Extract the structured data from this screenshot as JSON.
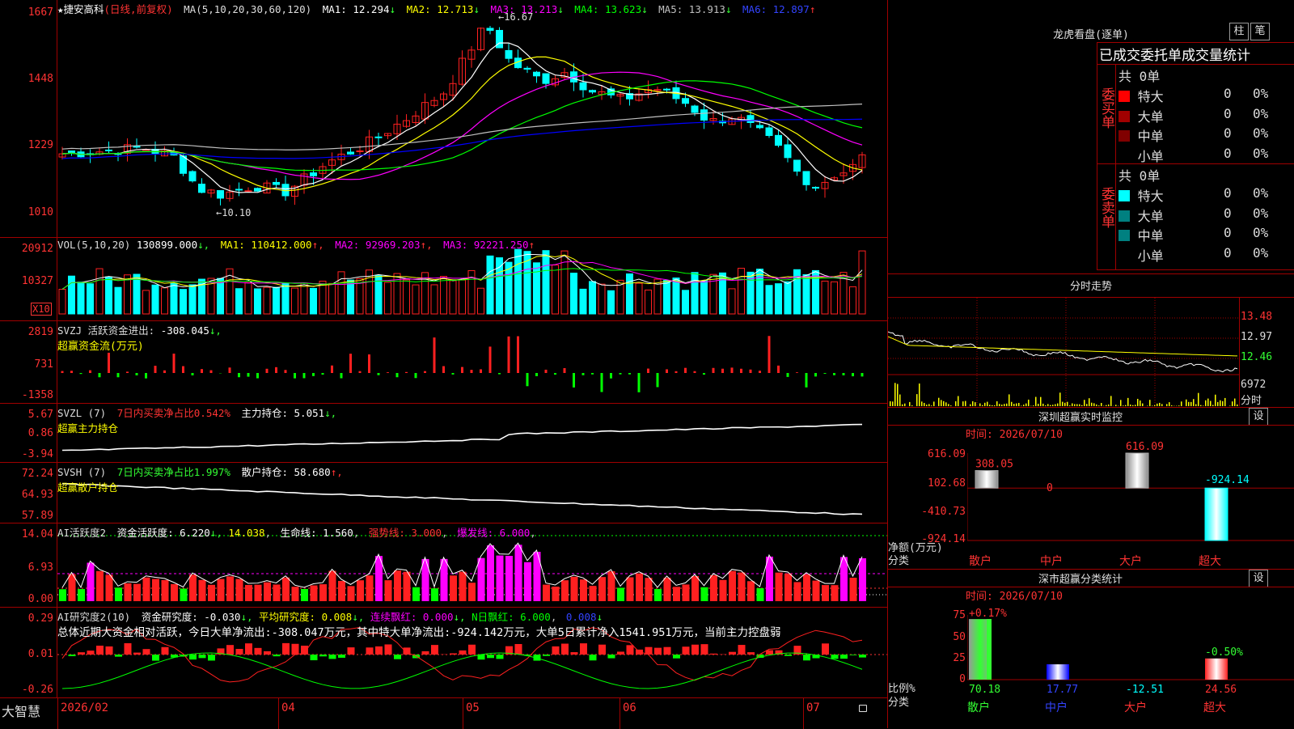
{
  "colors": {
    "up": "#ff2020",
    "down": "#00ffff",
    "ma1": "#ffffff",
    "ma2": "#ffff00",
    "ma3": "#ff00ff",
    "ma4": "#00ff00",
    "ma5": "#c0c0c0",
    "ma6": "#0000ff"
  },
  "kline": {
    "stock": "★捷安高科",
    "mode": "(日线,前复权)",
    "ma_params": "MA(5,10,20,30,60,120)",
    "ma": [
      {
        "name": "MA1:",
        "val": "12.294"
      },
      {
        "name": "MA2:",
        "val": "12.713"
      },
      {
        "name": "MA3:",
        "val": "13.213"
      },
      {
        "name": "MA4:",
        "val": "13.623"
      },
      {
        "name": "MA5:",
        "val": "13.913"
      },
      {
        "name": "MA6:",
        "val": "12.897"
      }
    ],
    "ylabels": [
      "1667",
      "1448",
      "1229",
      "1010"
    ],
    "max_label": "←16.67",
    "min_label": "←10.10"
  },
  "vol": {
    "title": "VOL(5,10,20)",
    "v": "130899.000",
    "ma1": "MA1: 110412.000",
    "ma2": "MA2: 92969.203",
    "ma3": "MA3: 92221.250",
    "ylabels": [
      "20912",
      "10327"
    ],
    "unit": "X10"
  },
  "svzj": {
    "title": "SVZJ  活跃资金进出:",
    "v": "-308.045",
    "sub": "超赢资金流(万元)",
    "ylabels": [
      "2819",
      "731",
      "-1358"
    ]
  },
  "svzl": {
    "title": "SVZL (7)",
    "pct": "7日内买卖净占比0.542%",
    "hold": "主力持仓: 5.051",
    "sub": "超赢主力持仓",
    "ylabels": [
      "5.67",
      "0.86",
      "-3.94"
    ]
  },
  "svsh": {
    "title": "SVSH (7)",
    "pct": "7日内买卖净占比1.997%",
    "hold": "散户持仓: 58.680",
    "sub": "超赢散户持仓",
    "ylabels": [
      "72.24",
      "64.93",
      "57.89"
    ]
  },
  "ai1": {
    "title": "AI活跃度2",
    "a": "资金活跃度: 6.220",
    "b": "14.038",
    "c": "生命线: 1.560",
    "d": "强势线: 3.000",
    "e": "爆发线: 6.000",
    "ylabels": [
      "14.04",
      "6.93",
      "0.00"
    ]
  },
  "ai2": {
    "title": "AI研究度2(10)",
    "a": "资金研究度: -0.030",
    "b": "平均研究度: 0.008",
    "c": "连续飘红: 0.000",
    "d": "N日飘红: 6.000",
    "e": "0.008",
    "summary": "总体近期大资金相对活跃，今日大单净流出:-308.047万元，其中特大单净流出:-924.142万元，大单5日累计净入1541.951万元，当前主力控盘弱",
    "ylabels": [
      "0.29",
      "0.01",
      "-0.26"
    ]
  },
  "xaxis": {
    "brand": "大智慧",
    "labels": [
      "2026/02",
      "04",
      "05",
      "06",
      "07"
    ]
  },
  "lhb": {
    "title": "龙虎看盘(逐单)",
    "btn1": "柱",
    "btn2": "笔",
    "header": "已成交委托单成交量统计",
    "buy_label": "委买单",
    "sell_label": "委卖单",
    "buy_total": "共 0单",
    "sell_total": "共 0单",
    "buy_rows": [
      {
        "name": "特大",
        "n": "0",
        "p": "0%",
        "c": "#ff0000"
      },
      {
        "name": "大单",
        "n": "0",
        "p": "0%",
        "c": "#a00000"
      },
      {
        "name": "中单",
        "n": "0",
        "p": "0%",
        "c": "#800000"
      },
      {
        "name": "小单",
        "n": "0",
        "p": "0%",
        "c": ""
      }
    ],
    "sell_rows": [
      {
        "name": "特大",
        "n": "0",
        "p": "0%",
        "c": "#00ffff"
      },
      {
        "name": "大单",
        "n": "0",
        "p": "0%",
        "c": "#008080"
      },
      {
        "name": "中单",
        "n": "0",
        "p": "0%",
        "c": "#008080"
      },
      {
        "name": "小单",
        "n": "0",
        "p": "0%",
        "c": ""
      }
    ]
  },
  "intraday": {
    "title": "分时走势",
    "ylabels": [
      "13.48",
      "12.97",
      "12.46"
    ],
    "vol_label": "6972",
    "time_label": "分时"
  },
  "szmon": {
    "title": "深圳超赢实时监控",
    "btn": "设",
    "time": "时间: 2026/07/10",
    "ylabels": [
      "616.09",
      "102.68",
      "-410.73",
      "-924.14"
    ],
    "unit": "净额(万元)",
    "cls": "分类",
    "cats": [
      "散户",
      "中户",
      "大户",
      "超大"
    ],
    "values": [
      308.05,
      0,
      616.09,
      -924.14
    ],
    "labels": [
      "308.05",
      "0",
      "616.09",
      "-924.14"
    ]
  },
  "szcls": {
    "title": "深市超赢分类统计",
    "btn": "设",
    "time": "时间: 2026/07/10",
    "ylabels": [
      "75",
      "50",
      "25",
      "0"
    ],
    "unit": "比例%",
    "cls": "分类",
    "cats": [
      "散户",
      "中户",
      "大户",
      "超大"
    ],
    "values": [
      70.18,
      17.77,
      -12.51,
      24.56
    ],
    "labels": [
      "70.18",
      "17.77",
      "-12.51",
      "24.56"
    ],
    "top1": "+0.17%",
    "top4": "-0.50%"
  }
}
